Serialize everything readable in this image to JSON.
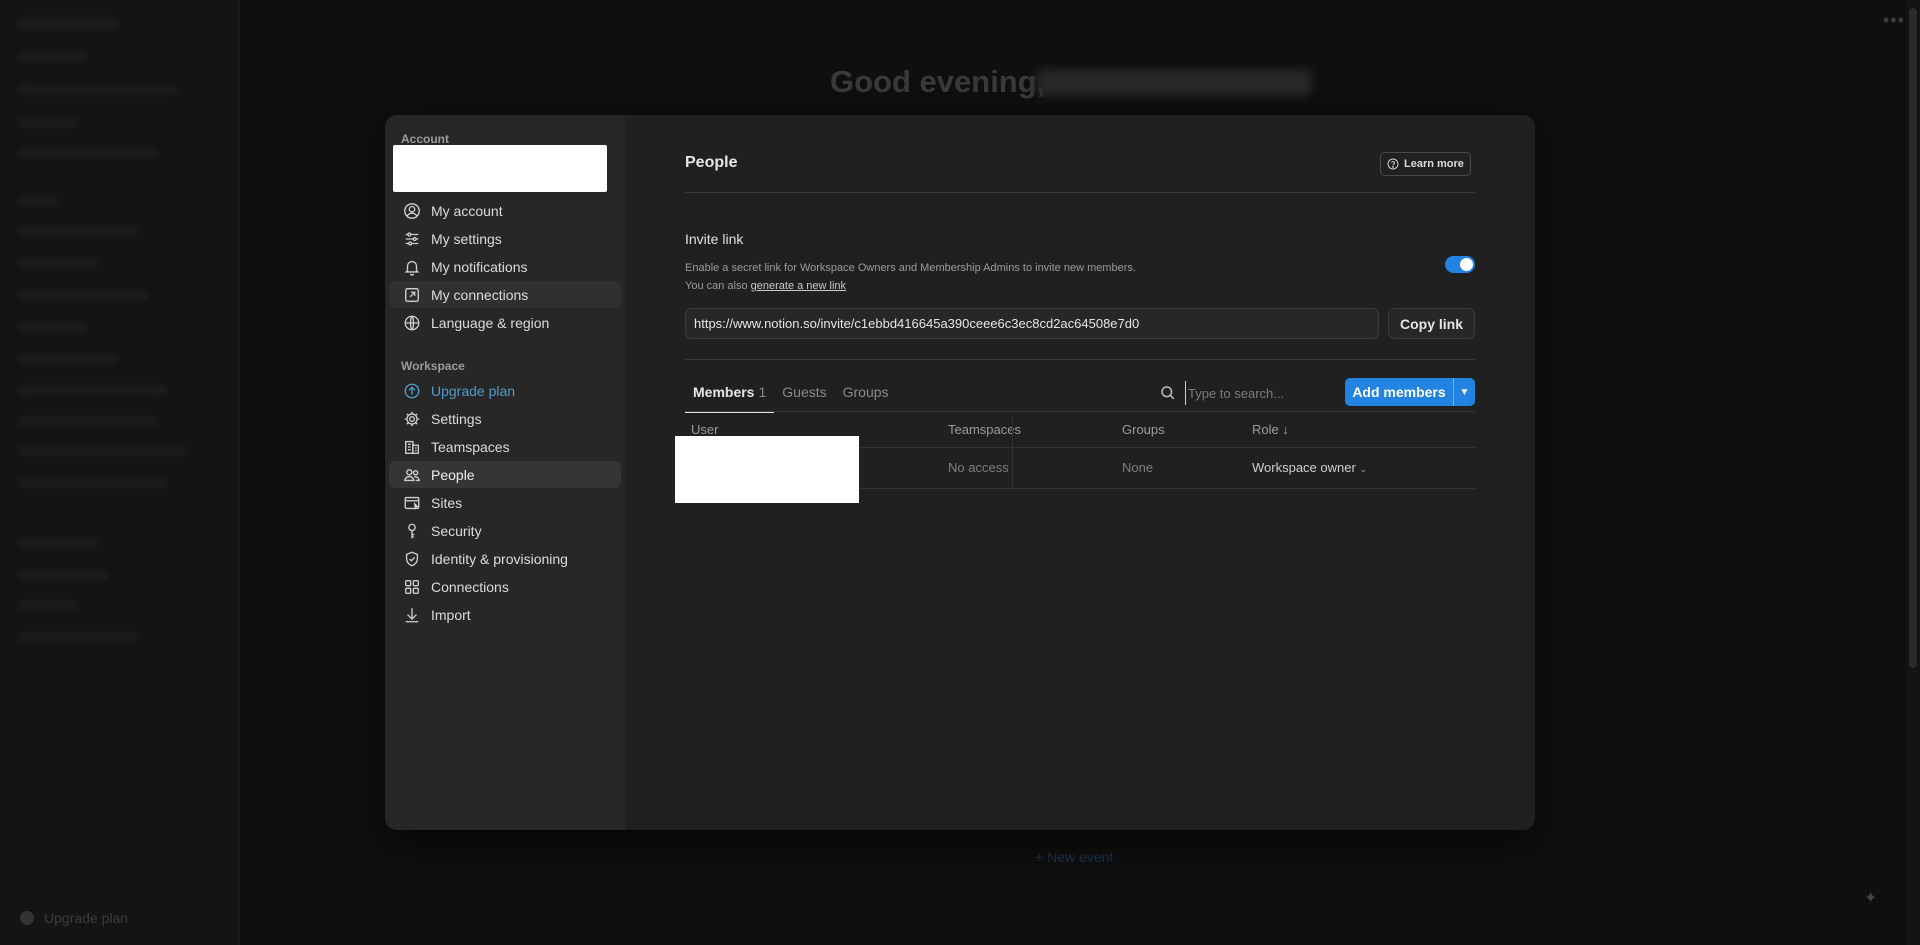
{
  "background": {
    "greeting": "Good evening,",
    "upgrade_label": "Upgrade plan",
    "new_event": "+ New event"
  },
  "settings_nav": {
    "account_section": "Account",
    "account_items": [
      {
        "label": "My account",
        "icon": "user-circle-icon"
      },
      {
        "label": "My settings",
        "icon": "sliders-icon"
      },
      {
        "label": "My notifications",
        "icon": "bell-icon"
      },
      {
        "label": "My connections",
        "icon": "arrow-up-right-box-icon"
      },
      {
        "label": "Language & region",
        "icon": "globe-icon"
      }
    ],
    "workspace_section": "Workspace",
    "workspace_items": [
      {
        "label": "Upgrade plan",
        "icon": "arrow-up-circle-icon"
      },
      {
        "label": "Settings",
        "icon": "gear-icon"
      },
      {
        "label": "Teamspaces",
        "icon": "building-icon"
      },
      {
        "label": "People",
        "icon": "people-icon"
      },
      {
        "label": "Sites",
        "icon": "browser-icon"
      },
      {
        "label": "Security",
        "icon": "key-icon"
      },
      {
        "label": "Identity & provisioning",
        "icon": "shield-check-icon"
      },
      {
        "label": "Connections",
        "icon": "grid-icon"
      },
      {
        "label": "Import",
        "icon": "download-arrow-icon"
      }
    ]
  },
  "people": {
    "title": "People",
    "learn_more": "Learn more",
    "invite": {
      "title": "Invite link",
      "desc_line1": "Enable a secret link for Workspace Owners and Membership Admins to invite new members.",
      "desc_line2_prefix": "You can also ",
      "desc_line2_link": "generate a new link",
      "toggle_on": true,
      "url": "https://www.notion.so/invite/c1ebbd416645a390ceee6c3ec8cd2ac64508e7d0",
      "copy_label": "Copy link"
    },
    "tabs": [
      {
        "label": "Members",
        "count": "1"
      },
      {
        "label": "Guests"
      },
      {
        "label": "Groups"
      }
    ],
    "search_placeholder": "Type to search...",
    "add_members": "Add members",
    "table": {
      "headers": {
        "user": "User",
        "teamspaces": "Teamspaces",
        "groups": "Groups",
        "role": "Role ↓"
      },
      "rows": [
        {
          "teamspaces": "No access",
          "groups": "None",
          "role": "Workspace owner"
        }
      ]
    }
  },
  "colors": {
    "accent": "#2383e2",
    "modal_bg": "#202020",
    "sidebar_bg": "#272727",
    "link_blue": "#529cca"
  }
}
